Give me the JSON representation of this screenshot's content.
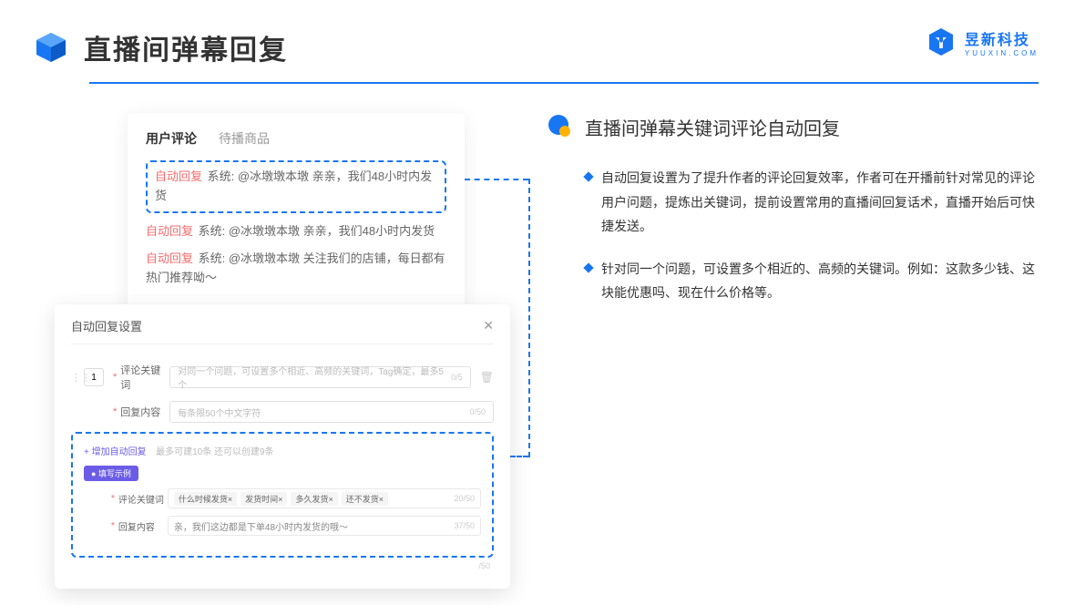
{
  "header": {
    "title": "直播间弹幕回复",
    "brand_main": "昱新科技",
    "brand_sub": "YUUXIN.COM"
  },
  "panel1": {
    "tabs": [
      "用户评论",
      "待播商品"
    ],
    "highlight": {
      "tag": "自动回复",
      "text": "系统: @冰墩墩本墩 亲亲，我们48小时内发货"
    },
    "replies": [
      {
        "tag": "自动回复",
        "text": "系统: @冰墩墩本墩 亲亲，我们48小时内发货"
      },
      {
        "tag": "自动回复",
        "text": "系统: @冰墩墩本墩 关注我们的店铺，每日都有热门推荐呦～"
      }
    ]
  },
  "panel2": {
    "title": "自动回复设置",
    "num": "1",
    "row1": {
      "label": "评论关键词",
      "placeholder": "对同一个问题，可设置多个相近、高频的关键词，Tag确定，最多5个",
      "count": "0/5"
    },
    "row2": {
      "label": "回复内容",
      "placeholder": "每条限50个中文字符",
      "count": "0/50"
    },
    "add_link": "+ 增加自动回复",
    "add_after": "最多可建10条 还可以创建9条",
    "badge": "● 填写示例",
    "ex1": {
      "label": "评论关键词",
      "chips": [
        "什么时候发货×",
        "发货时间×",
        "多久发货×",
        "还不发货×"
      ],
      "count": "20/50"
    },
    "ex2": {
      "label": "回复内容",
      "text": "亲，我们这边都是下单48小时内发货的哦～",
      "count": "37/50"
    },
    "tail_count": "/50"
  },
  "right": {
    "section_title": "直播间弹幕关键词评论自动回复",
    "bullets": [
      "自动回复设置为了提升作者的评论回复效率，作者可在开播前针对常见的评论用户问题，提炼出关键词，提前设置常用的直播间回复话术，直播开始后可快捷发送。",
      "针对同一个问题，可设置多个相近的、高频的关键词。例如：这款多少钱、这块能优惠吗、现在什么价格等。"
    ]
  }
}
